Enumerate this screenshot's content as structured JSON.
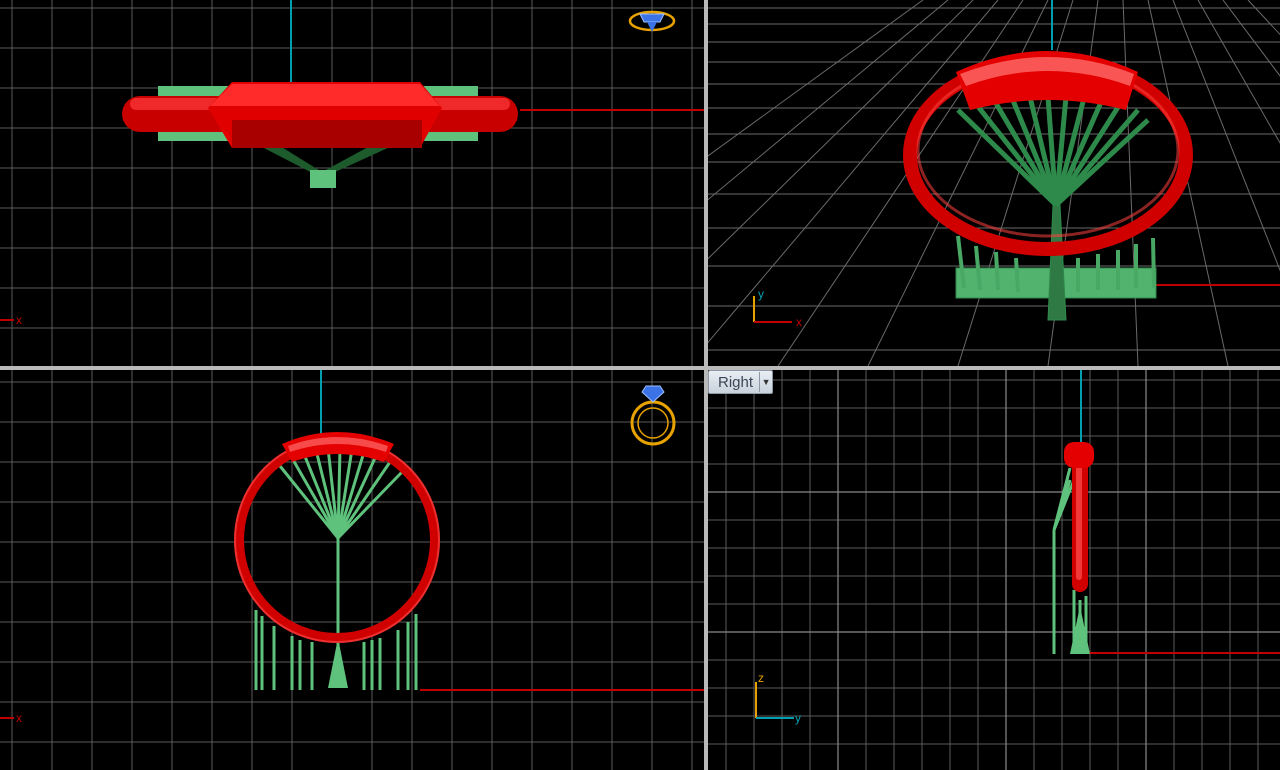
{
  "viewports": {
    "top": {
      "axis_x": "x"
    },
    "perspective": {
      "axis_x": "x",
      "axis_y": "y"
    },
    "front": {
      "axis_x": "x"
    },
    "right": {
      "label": "Right",
      "axis_y": "y",
      "axis_z": "z"
    }
  },
  "icons": {
    "view_cube_top": "ring-top-view-icon",
    "view_cube_front": "ring-front-view-icon",
    "viewport_menu": "chevron-down-icon"
  },
  "colors": {
    "background": "#000000",
    "grid": "#5a5a5a",
    "grid_major": "#8a8a8a",
    "axis_x": "#c00000",
    "axis_y": "#009fb0",
    "model_ring": "#e40000",
    "model_supports": "#5ec27c",
    "gizmo": "#e8a200",
    "splitter": "#b9b9b9"
  }
}
